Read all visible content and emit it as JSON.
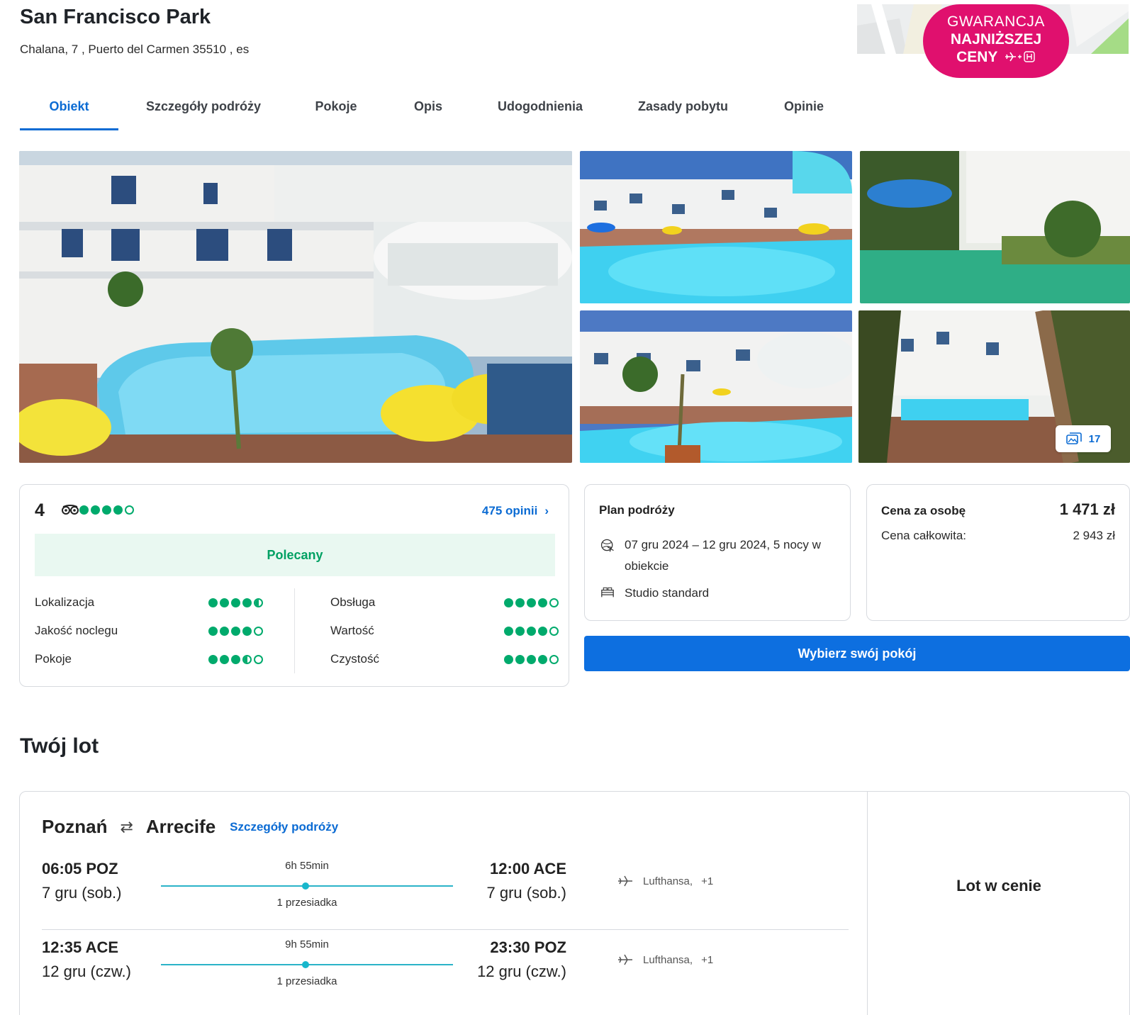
{
  "hotel": {
    "name": "San Francisco Park",
    "address": "Chalana, 7 , Puerto del Carmen 35510 , es"
  },
  "badge": {
    "line1": "GWARANCJA",
    "line2": "NAJNIŻSZEJ",
    "line3": "CENY",
    "icon": "plane-plus-hotel-icon",
    "color": "#e0106e"
  },
  "tabs": [
    {
      "label": "Obiekt",
      "active": true
    },
    {
      "label": "Szczegóły podróży"
    },
    {
      "label": "Pokoje"
    },
    {
      "label": "Opis"
    },
    {
      "label": "Udogodnienia"
    },
    {
      "label": "Zasady pobytu"
    },
    {
      "label": "Opinie"
    }
  ],
  "gallery": {
    "photo_count": "17",
    "count_icon": "images-icon"
  },
  "reviews": {
    "score": "4",
    "overall_bubbles": 4,
    "reviews_link": "475 opinii",
    "recommendation": "Polecany",
    "categories_left": [
      {
        "label": "Lokalizacja",
        "rating": 4.5
      },
      {
        "label": "Jakość noclegu",
        "rating": 4
      },
      {
        "label": "Pokoje",
        "rating": 3.5
      }
    ],
    "categories_right": [
      {
        "label": "Obsługa",
        "rating": 4
      },
      {
        "label": "Wartość",
        "rating": 4
      },
      {
        "label": "Czystość",
        "rating": 4
      }
    ],
    "accent_color": "#00aa6c"
  },
  "plan": {
    "title": "Plan podróży",
    "dates": "07 gru 2024 – 12 gru 2024, 5 nocy w obiekcie",
    "room": "Studio standard"
  },
  "price": {
    "per_person_label": "Cena za osobę",
    "per_person_value": "1 471 zł",
    "total_label": "Cena całkowita:",
    "total_value": "2 943 zł"
  },
  "cta": {
    "label": "Wybierz swój pokój",
    "color": "#0d6fe0"
  },
  "flight": {
    "section_title": "Twój lot",
    "origin": "Poznań",
    "destination": "Arrecife",
    "details_link": "Szczegóły podróży",
    "included_label": "Lot w cenie",
    "legs": [
      {
        "dep_time": "06:05 POZ",
        "dep_date": "7 gru (sob.)",
        "duration": "6h 55min",
        "stops": "1 przesiadka",
        "arr_time": "12:00 ACE",
        "arr_date": "7 gru (sob.)",
        "airline": "Lufthansa,",
        "extra": "+1"
      },
      {
        "dep_time": "12:35 ACE",
        "dep_date": "12 gru (czw.)",
        "duration": "9h 55min",
        "stops": "1 przesiadka",
        "arr_time": "23:30 POZ",
        "arr_date": "12 gru (czw.)",
        "airline": "Lufthansa,",
        "extra": "+1"
      }
    ]
  }
}
